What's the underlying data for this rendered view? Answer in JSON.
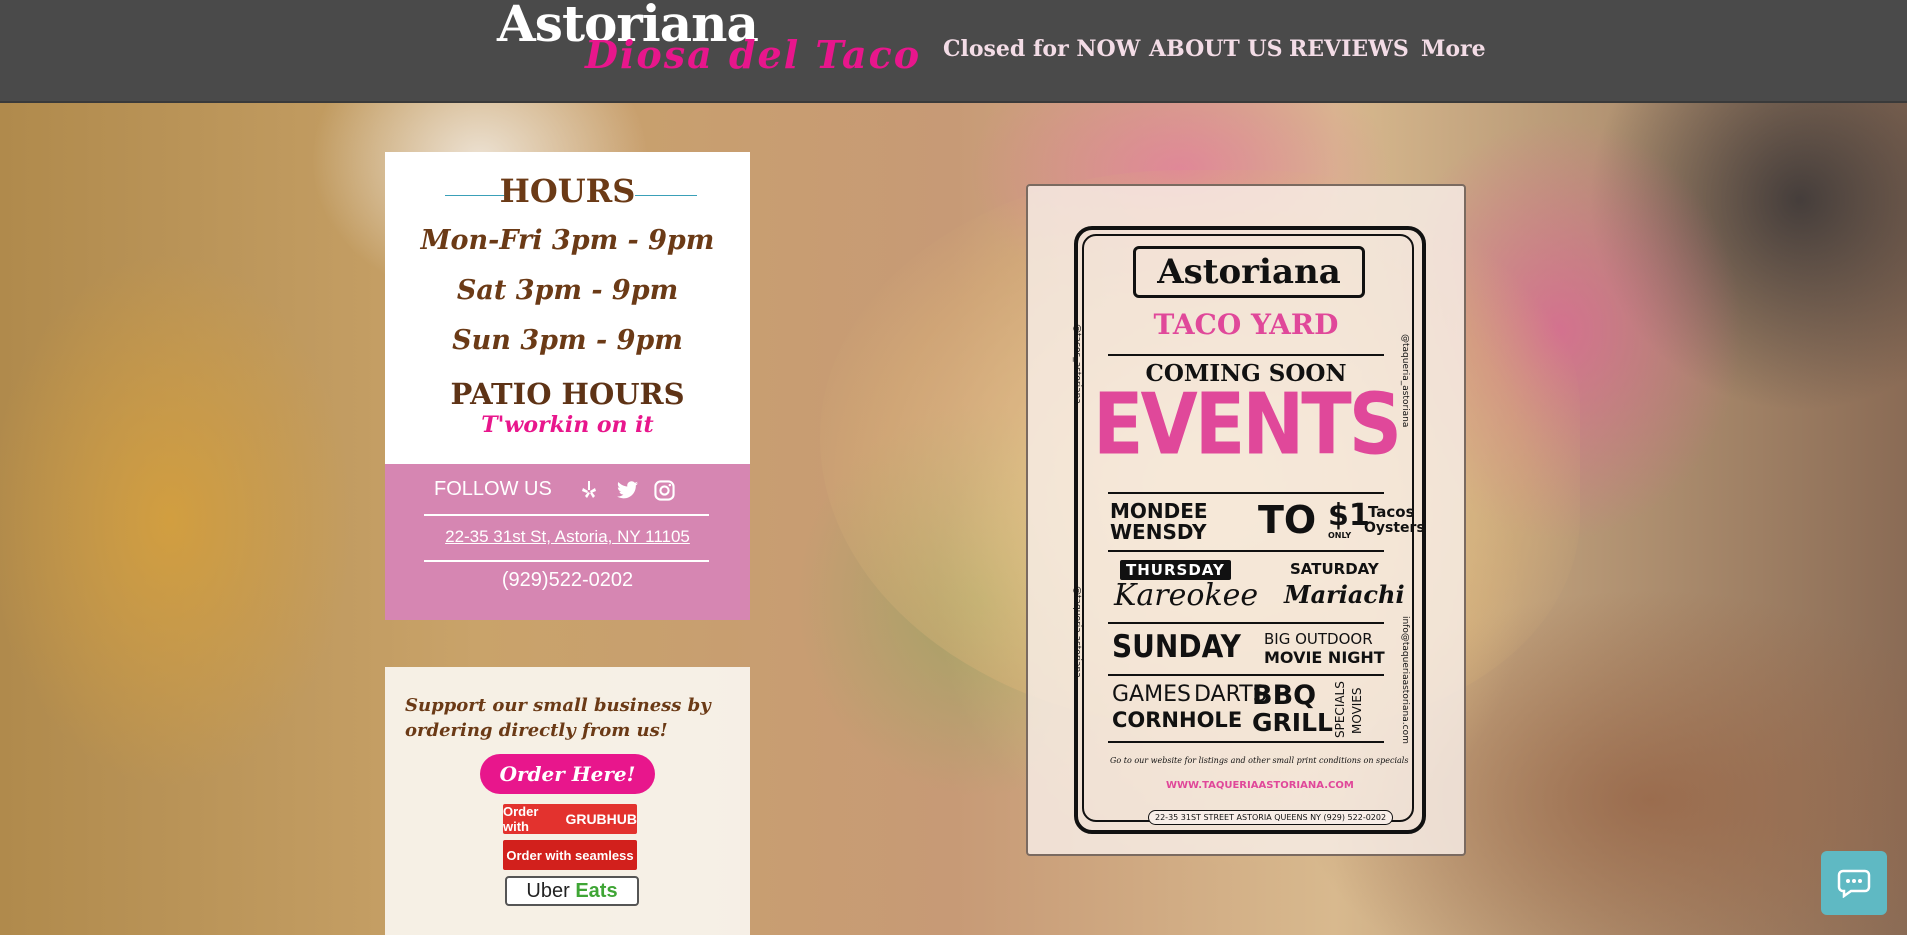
{
  "header": {
    "brand_top": "Astoriana",
    "brand_sub": "Diosa del Taco",
    "nav": [
      "Closed for NOW",
      "ABOUT US",
      "REVIEWS",
      "More"
    ]
  },
  "hours": {
    "title": "HOURS",
    "rows": [
      "Mon-Fri 3pm - 9pm",
      "Sat 3pm - 9pm",
      "Sun 3pm - 9pm"
    ],
    "patio_title": "PATIO HOURS",
    "patio_note": "T'workin on it"
  },
  "follow": {
    "label": "FOLLOW US",
    "icons": [
      "yelp-icon",
      "twitter-icon",
      "instagram-icon"
    ],
    "address": "22-35 31st St, Astoria, NY 11105",
    "phone": "(929)522-0202"
  },
  "order": {
    "support_text": "Support our small business by ordering directly from us!",
    "order_button": "Order Here!",
    "grubhub_prefix": "Order with",
    "grubhub_brand": "GRUBHUB",
    "seamless_prefix": "Order with",
    "seamless_brand": "seamless",
    "uber_a": "Uber",
    "uber_b": "Eats"
  },
  "poster": {
    "title": "Astoriana",
    "taco_yard": "TACO YARD",
    "coming_soon": "COMING SOON",
    "events": "EVENTS",
    "mondee": "MONDEE",
    "wensdy": "WENSDY",
    "tacos_num": "TO",
    "one_dollar": "$1",
    "only": "ONLY",
    "tacos": "Tacos",
    "oysters": "Oysters",
    "thursday": "THURSDAY",
    "kareokee": "Kareokee",
    "saturday": "SATURDAY",
    "mariachi": "Mariachi",
    "sunday": "SUNDAY",
    "big_outdoor": "BIG OUTDOOR",
    "movie_night": "MOVIE NIGHT",
    "games": "GAMES",
    "darts": "DARTS",
    "cornhole": "CORNHOLE",
    "bbq": "BBQ",
    "grill": "GRILL",
    "specials": "SPECIALS",
    "movies": "MOVIES",
    "fine_print": "Go to our website for listings and other small print conditions on specials",
    "website": "WWW.TAQUERIAASTORIANA.COM",
    "address": "22-35 31ST STREET  ASTORIA  QUEENS  NY  (929) 522-0202",
    "side_left_1": "@tacos_astoriana",
    "side_left_2": "@taqueria.astoriana",
    "side_right_1": "@taqueria_astoriana",
    "side_right_2": "info@taqueriaastoriana.com"
  },
  "colors": {
    "accent": "#e8168c",
    "header_bg": "#4a4a4a",
    "follow_bg": "#d686b2",
    "brown": "#6b3a16",
    "chat": "#5fb9c3"
  }
}
